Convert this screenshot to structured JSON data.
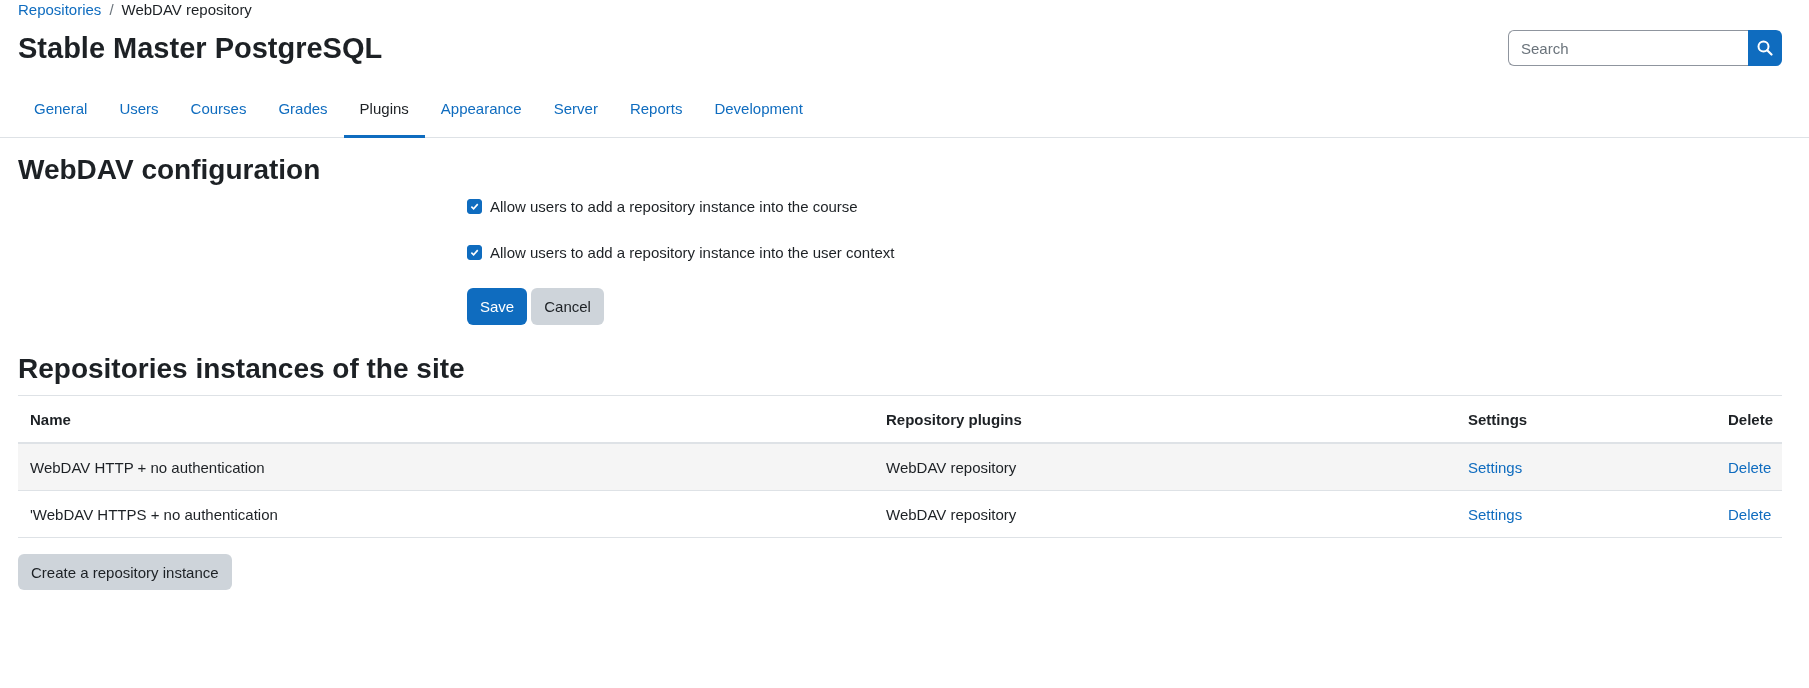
{
  "breadcrumb": {
    "separator": "/",
    "items": [
      "Repositories",
      "WebDAV repository"
    ]
  },
  "page_title": "Stable Master PostgreSQL",
  "search": {
    "placeholder": "Search"
  },
  "tabs": [
    {
      "label": "General",
      "selected": false
    },
    {
      "label": "Users",
      "selected": false
    },
    {
      "label": "Courses",
      "selected": false
    },
    {
      "label": "Grades",
      "selected": false
    },
    {
      "label": "Plugins",
      "selected": true
    },
    {
      "label": "Appearance",
      "selected": false
    },
    {
      "label": "Server",
      "selected": false
    },
    {
      "label": "Reports",
      "selected": false
    },
    {
      "label": "Development",
      "selected": false
    }
  ],
  "config": {
    "heading": "WebDAV configuration",
    "options": [
      {
        "label": "Allow users to add a repository instance into the course",
        "checked": true
      },
      {
        "label": "Allow users to add a repository instance into the user context",
        "checked": true
      }
    ],
    "buttons": [
      {
        "label": "Save",
        "kind": "primary"
      },
      {
        "label": "Cancel",
        "kind": "secondary"
      }
    ]
  },
  "instances": {
    "heading": "Repositories instances of the site",
    "columns": [
      "Name",
      "Repository plugins",
      "Settings",
      "Delete"
    ],
    "rows": [
      {
        "name": "WebDAV HTTP + no authentication",
        "plugin": "WebDAV repository",
        "settings": "Settings",
        "delete": "Delete"
      },
      {
        "name": "'WebDAV HTTPS + no authentication",
        "plugin": "WebDAV repository",
        "settings": "Settings",
        "delete": "Delete"
      }
    ],
    "create_button": "Create a repository instance"
  }
}
